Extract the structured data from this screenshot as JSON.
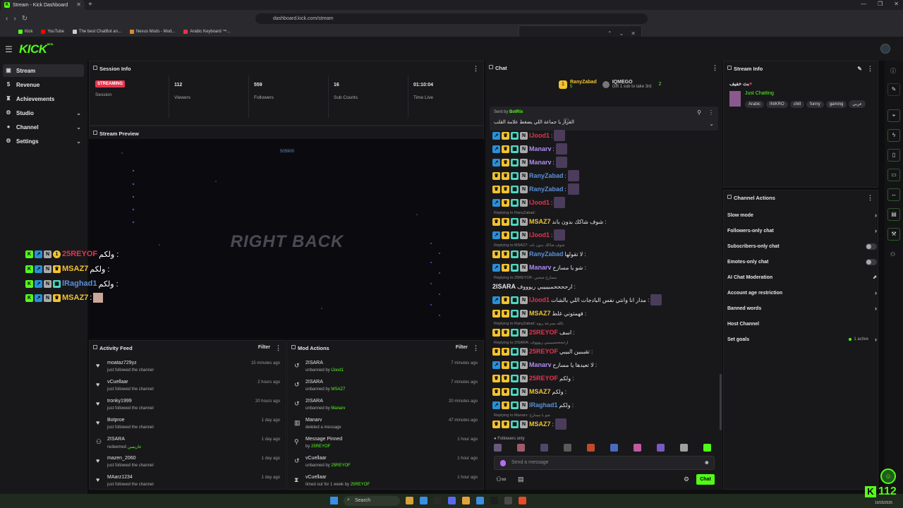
{
  "browser": {
    "tab_title": "Stream - Kick Dashboard",
    "url": "dashboard.kick.com/stream",
    "bookmarks": [
      "Kick",
      "YouTube",
      "The best ChatBot an...",
      "Nexus Mods - Mod...",
      "Arabic Keyboard ™..."
    ]
  },
  "app": {
    "logo": "KICK",
    "logo_sup": "BETA"
  },
  "sidebar": {
    "items": [
      {
        "label": "Stream",
        "icon": "stream-icon"
      },
      {
        "label": "Revenue",
        "icon": "dollar-icon"
      },
      {
        "label": "Achievements",
        "icon": "trophy-icon"
      },
      {
        "label": "Studio",
        "icon": "gear-icon"
      },
      {
        "label": "Channel",
        "icon": "user-icon"
      },
      {
        "label": "Settings",
        "icon": "settings-icon"
      }
    ]
  },
  "session": {
    "title": "Session Info",
    "status": "STREAMING",
    "session_label": "Session",
    "stats": [
      {
        "value": "112",
        "label": "Viewers"
      },
      {
        "value": "559",
        "label": "Followers"
      },
      {
        "value": "16",
        "label": "Sub Counts"
      },
      {
        "value": "01:10:04",
        "label": "Time Live"
      }
    ]
  },
  "preview": {
    "title": "Stream Preview",
    "overlay_text": "RIGHT BACK",
    "small_text": "505900"
  },
  "overlay_chat": [
    {
      "user": "25REYOF",
      "msg": "ولكم :",
      "color": "#e8334b"
    },
    {
      "user": "MSAZ7",
      "msg": "ولكم :",
      "color": "#f2c230"
    },
    {
      "user": "lRaghad1",
      "msg": "ولكم :",
      "color": "#5b8fd6"
    },
    {
      "user": "MSAZ7",
      "msg": ":",
      "color": "#f2c230"
    }
  ],
  "activity": {
    "title": "Activity Feed",
    "filter": "Filter",
    "rows": [
      {
        "name": "moataz729yz",
        "sub": "just followed the channel",
        "time": "15 minutes ago",
        "icon": "heart-icon"
      },
      {
        "name": "vCuellaar",
        "sub": "just followed the channel",
        "time": "2 hours ago",
        "icon": "heart-icon"
      },
      {
        "name": "tronky1999",
        "sub": "just followed the channel",
        "time": "20 hours ago",
        "icon": "heart-icon"
      },
      {
        "name": "Botproe",
        "sub": "just followed the channel",
        "time": "1 day ago",
        "icon": "heart-icon"
      },
      {
        "name": "2ISARA",
        "sub": "redeemed",
        "sub2": "عاريسن",
        "time": "1 day ago",
        "icon": "redeem-icon"
      },
      {
        "name": "mazen_2060",
        "sub": "just followed the channel",
        "time": "1 day ago",
        "icon": "heart-icon"
      },
      {
        "name": "MAarz1234",
        "sub": "just followed the channel",
        "time": "1 day ago",
        "icon": "heart-icon"
      }
    ]
  },
  "mod": {
    "title": "Mod Actions",
    "filter": "Filter",
    "rows": [
      {
        "name": "2ISARA",
        "sub": "unbanned by",
        "by": "lJood1",
        "time": "7 minutes ago",
        "icon": "undo-icon"
      },
      {
        "name": "2ISARA",
        "sub": "unbanned by",
        "by": "MSAZ7",
        "time": "7 minutes ago",
        "icon": "undo-icon"
      },
      {
        "name": "2ISARA",
        "sub": "unbanned by",
        "by": "Manarv",
        "time": "20 minutes ago",
        "icon": "undo-icon"
      },
      {
        "name": "Manarv",
        "sub": "deleted a message",
        "by": "",
        "time": "47 minutes ago",
        "icon": "trash-icon"
      },
      {
        "name": "Message Pinned",
        "sub": "by",
        "by": "25REYOF",
        "time": "1 hour ago",
        "icon": "pin-icon"
      },
      {
        "name": "vCuellaar",
        "sub": "unbanned by",
        "by": "25REYOF",
        "time": "1 hour ago",
        "icon": "undo-icon"
      },
      {
        "name": "vCuellaar",
        "sub": "timed out for 1 week by",
        "by": "25REYOF",
        "time": "1 hour ago",
        "icon": "hourglass-icon"
      }
    ]
  },
  "chat": {
    "title": "Chat",
    "top_gifter": "RanyZabad",
    "top_gifter_count": "5",
    "second": "IQMEGO",
    "second_count": "2",
    "gift_note": "Gift 1 sub to take 3rd",
    "pinned_by": "Sent by",
    "pinned_bot": "BotRix",
    "pinned_text": "القرار يا جماعة اللي يضغط علامة القلب",
    "lines": [
      {
        "user": "lJood1",
        "color": "#e8334b",
        "msg": ":",
        "emote": true
      },
      {
        "user": "Manarv",
        "color": "#b08cf0",
        "msg": ":",
        "emote": true
      },
      {
        "user": "Manarv",
        "color": "#b08cf0",
        "msg": ":",
        "emote": true
      },
      {
        "user": "RanyZabad",
        "color": "#5b8fd6",
        "msg": ":",
        "emote": true
      },
      {
        "user": "RanyZabad",
        "color": "#5b8fd6",
        "msg": ":",
        "emote": true
      },
      {
        "user": "lJood1",
        "color": "#e8334b",
        "msg": ":",
        "emote": true
      },
      {
        "reply": "Replying to RanyZabad:"
      },
      {
        "user": "MSAZ7",
        "color": "#f2c230",
        "msg": "شوف شاكك بدون باند :"
      },
      {
        "user": "lJood1",
        "color": "#e8334b",
        "msg": ":",
        "emote": true
      },
      {
        "reply": "Replying to MSAZ7: شوف شاكك بدون باند"
      },
      {
        "user": "RanyZabad",
        "color": "#5b8fd6",
        "msg": "لا تقولها :"
      },
      {
        "user": "Manarv",
        "color": "#b08cf0",
        "msg": "شو يا مسازح :"
      },
      {
        "reply": "Replying to 25REYOF: مسازح صحبي"
      },
      {
        "user": "2ISARA",
        "color": "#e6e6e8",
        "msg": "ارححححمبيبيبي ريوووف :",
        "plain": true
      },
      {
        "user": "lJood1",
        "color": "#e8334b",
        "msg": "مدار انا وانتي نفس البادجات اللي بالشات :",
        "emote": true
      },
      {
        "user": "MSAZ7",
        "color": "#f2c230",
        "msg": "فهمتوني غلط :"
      },
      {
        "reply": "Replying to RanyZabad: يالله بسرعة ريوه"
      },
      {
        "user": "25REYOF",
        "color": "#e8334b",
        "msg": "اسف :"
      },
      {
        "reply": "Replying to 2ISARA: ارححححمبيبيبي ريوووف"
      },
      {
        "user": "25REYOF",
        "color": "#e8334b",
        "msg": "تقبببين البيبي :"
      },
      {
        "user": "Manarv",
        "color": "#b08cf0",
        "msg": "لا تعيدها يا مسازح :"
      },
      {
        "user": "25REYOF",
        "color": "#e8334b",
        "msg": "ولكم :"
      },
      {
        "user": "MSAZ7",
        "color": "#f2c230",
        "msg": "ولكم :"
      },
      {
        "user": "lRaghad1",
        "color": "#5b8fd6",
        "msg": "ولكم :"
      },
      {
        "reply": "Replying to Manarv: شو يا مسازح"
      },
      {
        "user": "MSAZ7",
        "color": "#f2c230",
        "msg": ":",
        "emote": true
      }
    ],
    "followers_only": "Followers only",
    "input_placeholder": "Send a message",
    "send_label": "Chat"
  },
  "stream_info": {
    "title": "Stream Info",
    "stream_title": "بث خفيف",
    "category": "Just Chatting",
    "tags": [
      "Arabic",
      "INIKRO",
      "chill",
      "funny",
      "gaming",
      "عربي"
    ]
  },
  "channel_actions": {
    "title": "Channel Actions",
    "items": [
      {
        "label": "Slow mode",
        "ctl": "chevron"
      },
      {
        "label": "Followers-only chat",
        "ctl": "chevron"
      },
      {
        "label": "Subscribers-only chat",
        "ctl": "toggle"
      },
      {
        "label": "Emotes-only chat",
        "ctl": "toggle"
      },
      {
        "label": "AI Chat Moderation",
        "ctl": "external"
      },
      {
        "label": "Account age restriction",
        "ctl": "chevron"
      },
      {
        "label": "Banned words",
        "ctl": "chevron"
      },
      {
        "label": "Host Channel",
        "ctl": "none"
      },
      {
        "label": "Set goals",
        "ctl": "chevron",
        "note": "1 active"
      }
    ]
  },
  "viewer_overlay": {
    "count": "112"
  },
  "taskbar": {
    "search": "Search",
    "date": "10/25/2025"
  },
  "colors": {
    "brand": "#53fc18",
    "live": "#e8334b",
    "bg": "#0e0e10",
    "panel": "#18181b"
  }
}
